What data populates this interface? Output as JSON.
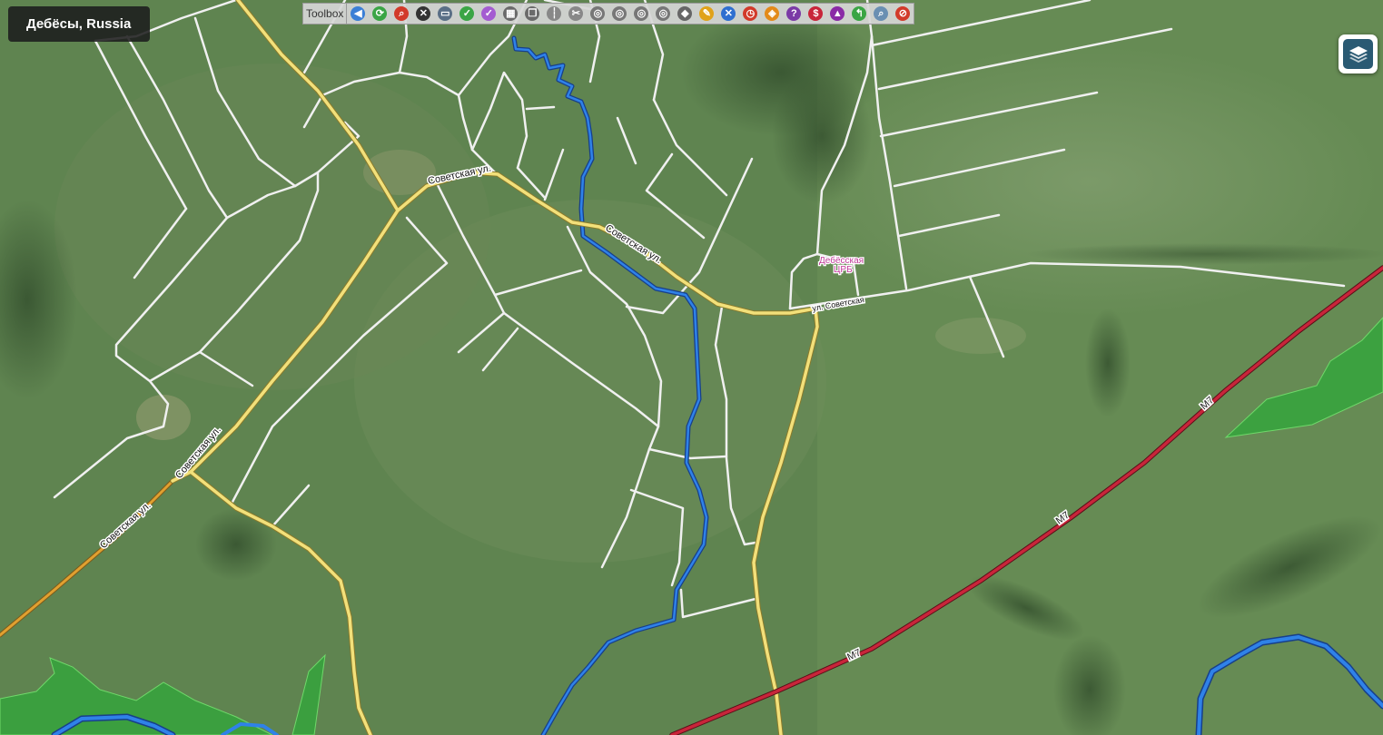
{
  "location": {
    "title": "Дебёсы, Russia"
  },
  "toolbar": {
    "label": "Toolbox",
    "tools": [
      {
        "name": "back-arrow-icon",
        "glyph": "◀",
        "color": "#3b7fd6"
      },
      {
        "name": "refresh-icon",
        "glyph": "⟳",
        "color": "#3aa545"
      },
      {
        "name": "zoom-search-icon",
        "glyph": "⌕",
        "color": "#d23a2a"
      },
      {
        "name": "tools-icon",
        "glyph": "✕",
        "color": "#333333"
      },
      {
        "name": "window-icon",
        "glyph": "▭",
        "color": "#5a6f86"
      },
      {
        "name": "check-icon",
        "glyph": "✓",
        "color": "#3aa545"
      },
      {
        "name": "shield-check-icon",
        "glyph": "✓",
        "color": "#a45cd1"
      },
      {
        "name": "grid-icon",
        "glyph": "▦",
        "color": "#6a6a6a"
      },
      {
        "name": "layers-copy-icon",
        "glyph": "❐",
        "color": "#6a6a6a"
      },
      {
        "name": "scissors-split-icon",
        "glyph": "┆",
        "color": "#888888"
      },
      {
        "name": "scissors-icon",
        "glyph": "✂",
        "color": "#888888"
      },
      {
        "name": "circle-tool-1-icon",
        "glyph": "◎",
        "color": "#777777"
      },
      {
        "name": "circle-tool-2-icon",
        "glyph": "◎",
        "color": "#777777"
      },
      {
        "name": "circle-tool-3-icon",
        "glyph": "◎",
        "color": "#777777"
      },
      {
        "name": "circle-tool-4-icon",
        "glyph": "◎",
        "color": "#777777"
      },
      {
        "name": "eraser-icon",
        "glyph": "◆",
        "color": "#666666"
      },
      {
        "name": "brush-icon",
        "glyph": "✎",
        "color": "#e0a21a"
      },
      {
        "name": "cross-lines-icon",
        "glyph": "✕",
        "color": "#2f6fd0"
      },
      {
        "name": "clock-icon",
        "glyph": "◷",
        "color": "#d23a2a"
      },
      {
        "name": "turn-sign-icon",
        "glyph": "◈",
        "color": "#e38a1a"
      },
      {
        "name": "help-icon",
        "glyph": "?",
        "color": "#7b3aa6"
      },
      {
        "name": "dollar-icon",
        "glyph": "$",
        "color": "#c8253a"
      },
      {
        "name": "warning-triangle-icon",
        "glyph": "▲",
        "color": "#8a2aa6"
      },
      {
        "name": "shield-arrow-icon",
        "glyph": "↰",
        "color": "#3aa545"
      },
      {
        "name": "magnifier-icon",
        "glyph": "⌕",
        "color": "#6a8fb2"
      },
      {
        "name": "no-route-icon",
        "glyph": "⊘",
        "color": "#d23a2a"
      }
    ]
  },
  "roads": {
    "sovetskaya_labels": [
      "Советская ул.",
      "Советская ул.",
      "Советская ул.",
      "Советская ул."
    ],
    "sovetskaya_alt": "ул. Советская",
    "highway": "M7"
  },
  "poi": {
    "line1": "Дебёсская",
    "line2": "ЦРБ"
  },
  "colors": {
    "major_road": "#f2e07a",
    "orange_road": "#e0a030",
    "minor_road": "#f2f2f2",
    "highway": "#c8253a",
    "river": "#1f6fd6",
    "forest": "#2fa83a"
  },
  "controls": {
    "layers_icon": "layers-icon"
  }
}
